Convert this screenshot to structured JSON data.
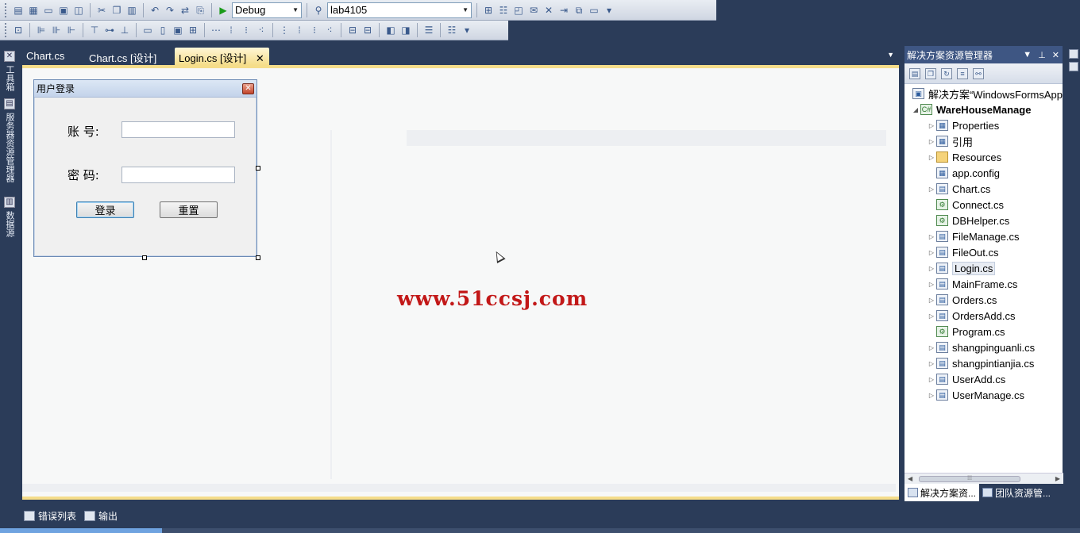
{
  "toolbar": {
    "config_value": "Debug",
    "project_value": "lab4105"
  },
  "left_strip": {
    "toolbox": "工具箱",
    "server_explorer": "服务器资源管理器",
    "datasource": "数据源"
  },
  "doc_tabs": [
    {
      "label": "Chart.cs"
    },
    {
      "label": "Chart.cs [设计]"
    },
    {
      "label": "Login.cs [设计]",
      "active": true
    }
  ],
  "form": {
    "title": "用户登录",
    "account_label": "账  号:",
    "password_label": "密  码:",
    "account_value": "",
    "password_value": "",
    "login_button": "登录",
    "reset_button": "重置"
  },
  "watermark": "www.51ccsj.com",
  "solution_explorer": {
    "title": "解决方案资源管理器",
    "solution": "解决方案“WindowsFormsApp",
    "project": "WareHouseManage",
    "items": [
      {
        "label": "Properties",
        "icon": "properties-icon",
        "expandable": true
      },
      {
        "label": "引用",
        "icon": "references-icon",
        "expandable": true
      },
      {
        "label": "Resources",
        "icon": "folder-icon",
        "expandable": true
      },
      {
        "label": "app.config",
        "icon": "config-file-icon",
        "expandable": false
      },
      {
        "label": "Chart.cs",
        "icon": "form-file-icon",
        "expandable": true
      },
      {
        "label": "Connect.cs",
        "icon": "cs-file-icon",
        "expandable": false
      },
      {
        "label": "DBHelper.cs",
        "icon": "cs-file-icon",
        "expandable": false
      },
      {
        "label": "FileManage.cs",
        "icon": "form-file-icon",
        "expandable": true
      },
      {
        "label": "FileOut.cs",
        "icon": "form-file-icon",
        "expandable": true
      },
      {
        "label": "Login.cs",
        "icon": "form-file-icon",
        "expandable": true,
        "selected": true
      },
      {
        "label": "MainFrame.cs",
        "icon": "form-file-icon",
        "expandable": true
      },
      {
        "label": "Orders.cs",
        "icon": "form-file-icon",
        "expandable": true
      },
      {
        "label": "OrdersAdd.cs",
        "icon": "form-file-icon",
        "expandable": true
      },
      {
        "label": "Program.cs",
        "icon": "cs-file-icon",
        "expandable": false
      },
      {
        "label": "shangpinguanli.cs",
        "icon": "form-file-icon",
        "expandable": true
      },
      {
        "label": "shangpintianjia.cs",
        "icon": "form-file-icon",
        "expandable": true
      },
      {
        "label": "UserAdd.cs",
        "icon": "form-file-icon",
        "expandable": true
      },
      {
        "label": "UserManage.cs",
        "icon": "form-file-icon",
        "expandable": true
      }
    ],
    "bottom_tabs": [
      {
        "label": "解决方案资..."
      },
      {
        "label": "团队资源管..."
      }
    ]
  },
  "bottom_tabs": [
    {
      "label": "错误列表"
    },
    {
      "label": "输出"
    }
  ],
  "progress": 0.15,
  "colors": {
    "ide_background": "#2b3c59",
    "active_tab": "#f5dd8a",
    "watermark": "#c21818"
  }
}
